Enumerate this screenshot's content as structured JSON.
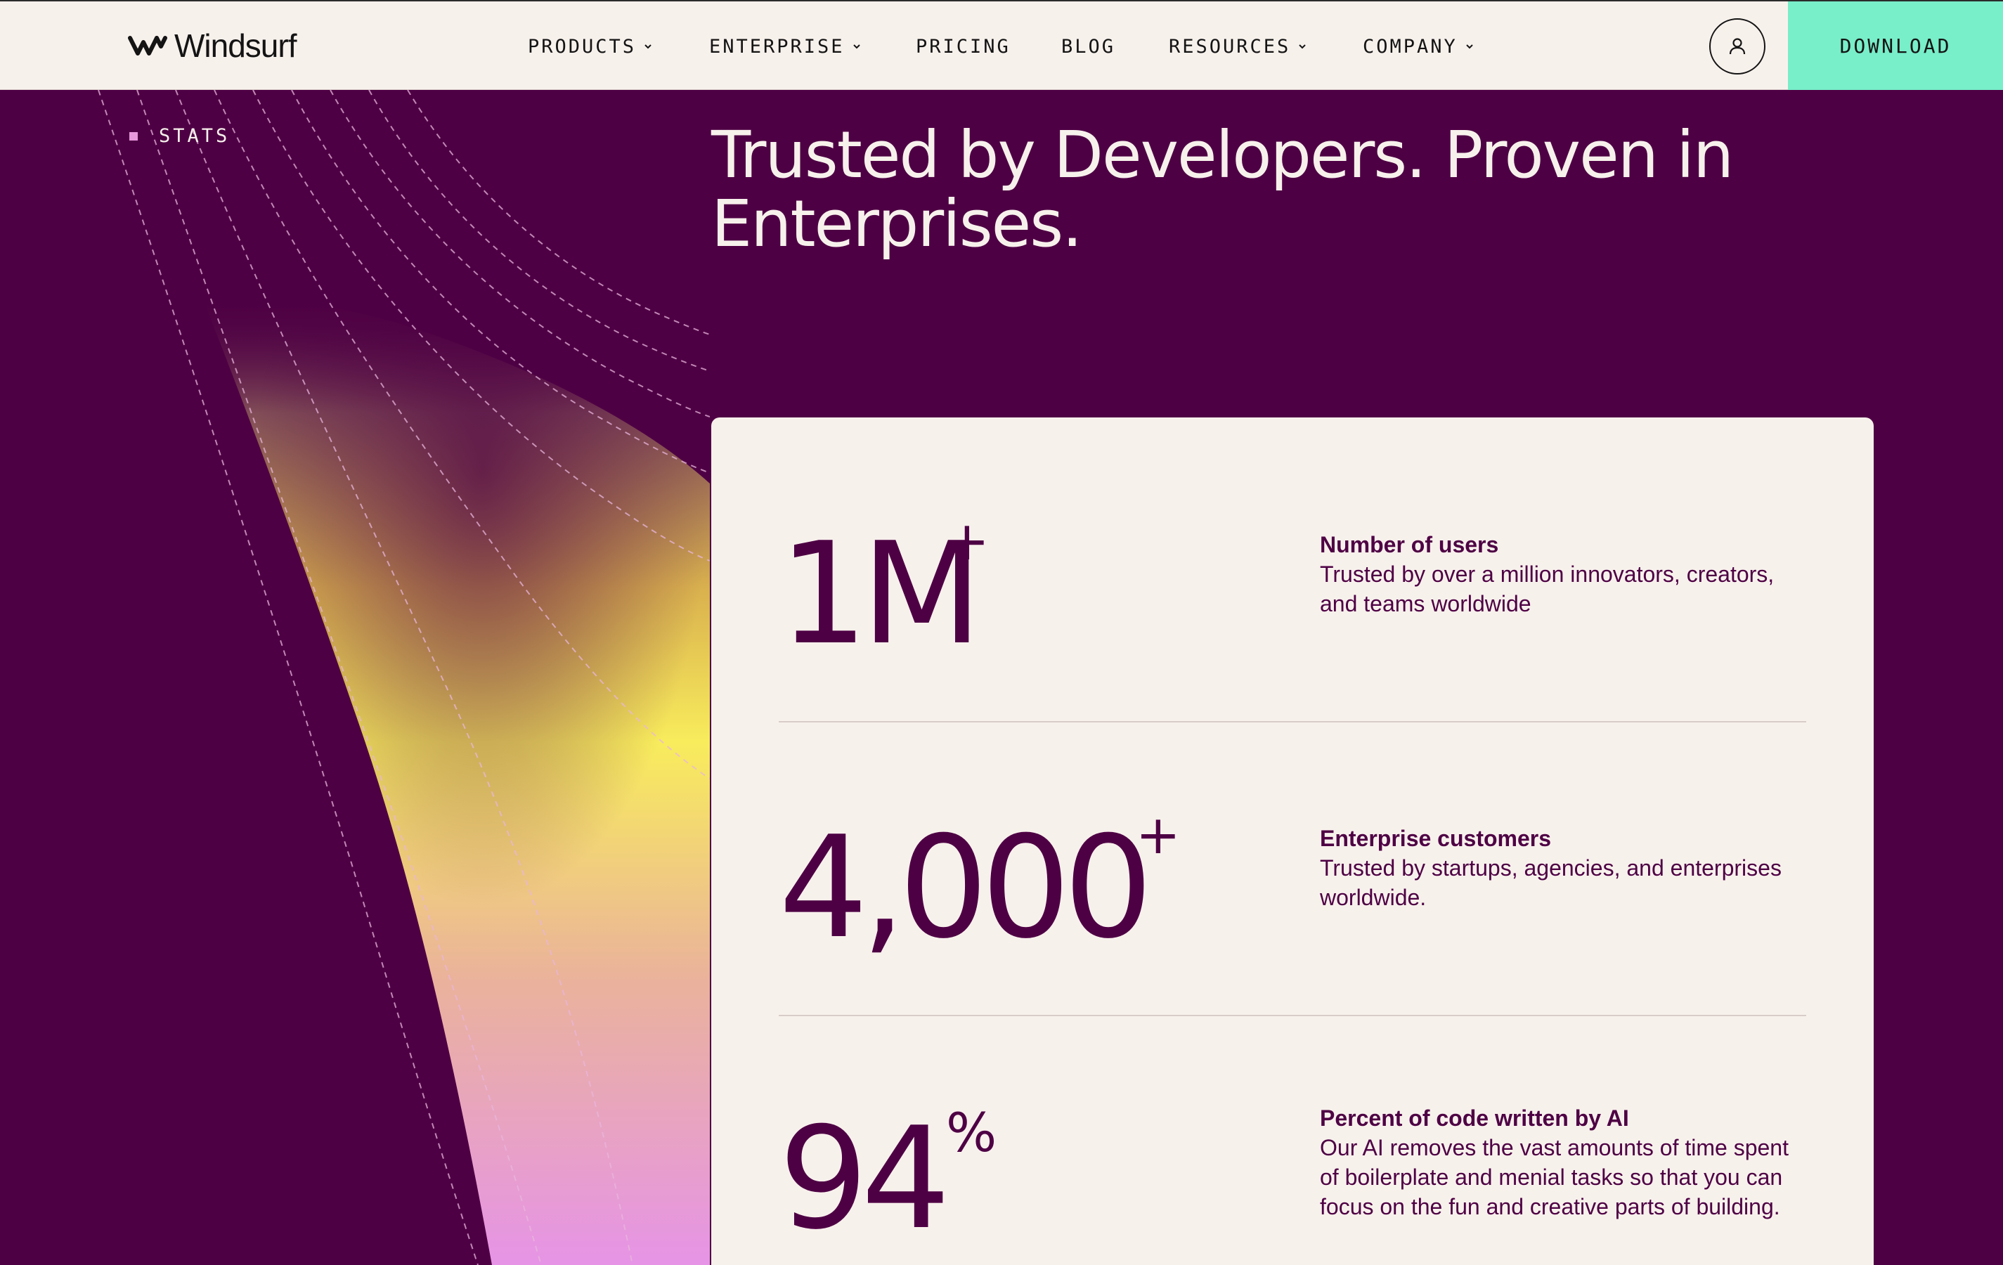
{
  "header": {
    "logo_text": "Windsurf",
    "nav": [
      {
        "label": "PRODUCTS",
        "has_dropdown": true
      },
      {
        "label": "ENTERPRISE",
        "has_dropdown": true
      },
      {
        "label": "PRICING",
        "has_dropdown": false
      },
      {
        "label": "BLOG",
        "has_dropdown": false
      },
      {
        "label": "RESOURCES",
        "has_dropdown": true
      },
      {
        "label": "COMPANY",
        "has_dropdown": true
      }
    ],
    "account_icon": "user-icon",
    "download_label": "DOWNLOAD"
  },
  "section": {
    "label": "STATS",
    "headline": "Trusted by Developers. Proven in Enterprises."
  },
  "stats": [
    {
      "value": "1M",
      "suffix": "+",
      "title": "Number of users",
      "description": "Trusted by over a million innovators, creators, and teams worldwide"
    },
    {
      "value": "4,000",
      "suffix": "+",
      "title": "Enterprise customers",
      "description": "Trusted by startups, agencies, and enterprises worldwide."
    },
    {
      "value": "94",
      "suffix": "%",
      "title": "Percent of code written by AI",
      "description": "Our AI removes the vast amounts of time spent of boilerplate and menial tasks so that you can focus on the fun and creative parts of building."
    }
  ],
  "colors": {
    "background": "#4e0044",
    "surface": "#f7f1ec",
    "accent": "#78eec9",
    "ink": "#141414",
    "bullet": "#e898dc",
    "gradient": [
      "#8a5a5a",
      "#f8ec5c",
      "#eab39a",
      "#e694e6"
    ]
  }
}
